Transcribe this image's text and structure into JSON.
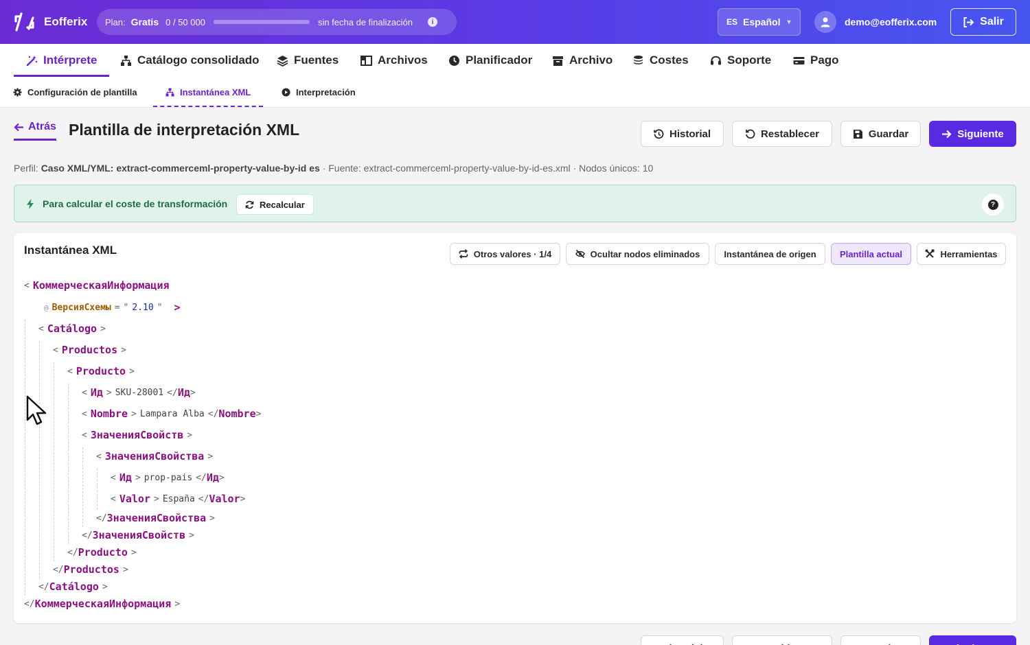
{
  "app": {
    "name": "Eofferix"
  },
  "plan": {
    "label": "Plan:",
    "name": "Gratis",
    "usage": "0 / 50 000",
    "progress_fraction": 0,
    "end": "sin fecha de finalización"
  },
  "language": {
    "code": "ES",
    "name": "Español"
  },
  "user": {
    "email": "demo@eofferix.com"
  },
  "logout_label": "Salir",
  "main_nav": [
    {
      "label": "Intérprete",
      "icon": "magic-wand-icon",
      "active": true
    },
    {
      "label": "Catálogo consolidado",
      "icon": "sitemap-icon"
    },
    {
      "label": "Fuentes",
      "icon": "layers-icon"
    },
    {
      "label": "Archivos",
      "icon": "columns-icon"
    },
    {
      "label": "Planificador",
      "icon": "clock-icon"
    },
    {
      "label": "Archivo",
      "icon": "archive-icon"
    },
    {
      "label": "Costes",
      "icon": "coins-icon"
    },
    {
      "label": "Soporte",
      "icon": "headset-icon"
    },
    {
      "label": "Pago",
      "icon": "credit-card-icon"
    }
  ],
  "sub_nav": [
    {
      "label": "Configuración de plantilla",
      "icon": "gear-icon"
    },
    {
      "label": "Instantánea XML",
      "icon": "sitemap-icon",
      "active": true
    },
    {
      "label": "Interpretación",
      "icon": "play-circle-icon"
    }
  ],
  "page": {
    "back_label": "Atrás",
    "title": "Plantilla de interpretación XML",
    "actions": {
      "history": "Historial",
      "reset": "Restablecer",
      "save": "Guardar",
      "next": "Siguiente"
    },
    "profile": {
      "prefix": "Perfil:",
      "name": "Caso XML/YML: extract-commerceml-property-value-by-id es",
      "source": "· Fuente: extract-commerceml-property-value-by-id-es.xml · Nodos únicos: 10"
    }
  },
  "alert": {
    "message": "Para calcular el coste de transformación",
    "recalc_label": "Recalcular",
    "help": "?"
  },
  "card": {
    "title": "Instantánea XML",
    "toolbar": {
      "other_values": "Otros valores · 1/4",
      "hide_deleted": "Ocultar nodos eliminados",
      "source_snapshot": "Instantánea de origen",
      "current_template": "Plantilla actual",
      "tools": "Herramientas"
    }
  },
  "xml": {
    "root": "КоммерческаяИнформация",
    "root_attr_name": "ВерсияСхемы",
    "root_attr_value": "2.10",
    "catalog": "Catálogo",
    "products": "Productos",
    "product": "Producto",
    "id_tag": "Ид",
    "id_value": "SKU-28001",
    "name_tag": "Nombre",
    "name_value": "Lampara Alba",
    "props_tag": "ЗначенияСвойств",
    "prop_tag": "ЗначенияСвойства",
    "prop_id_value": "prop-pais",
    "value_tag": "Valor",
    "value_value": "España"
  },
  "colors": {
    "brand": "#6a24c9",
    "primary_button": "#5a2ae2",
    "alert_bg": "#e0f3ea",
    "tag": "#8a1180",
    "attr": "#a15a00"
  }
}
